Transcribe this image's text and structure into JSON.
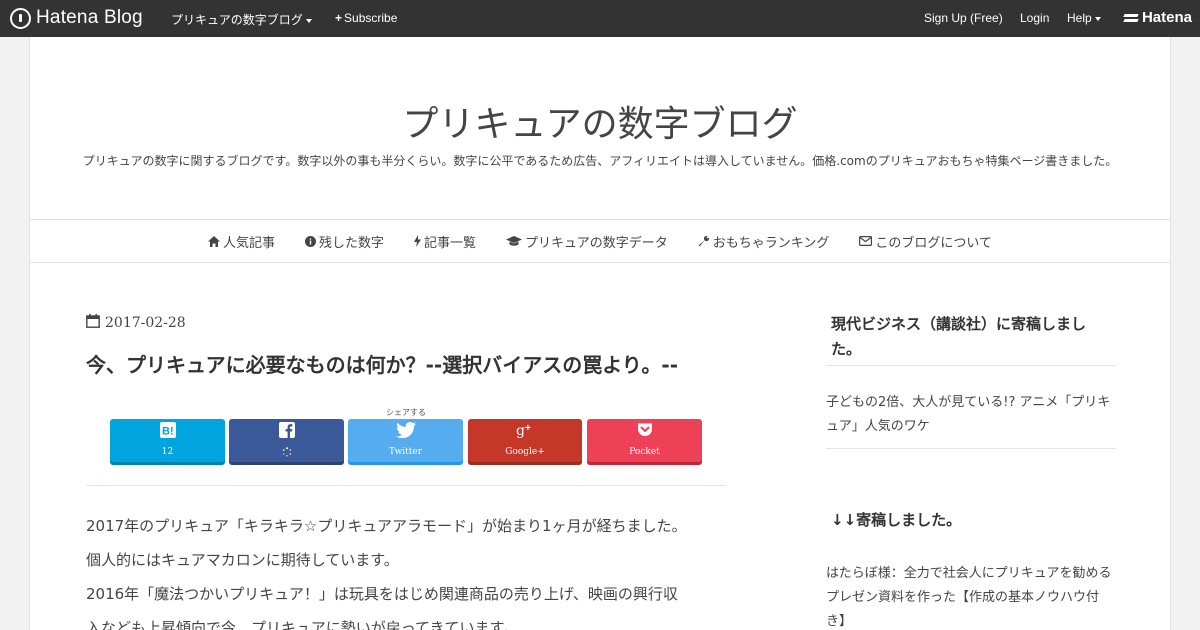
{
  "topbar": {
    "logo_text": "Hatena Blog",
    "blog_menu": "プリキュアの数字ブログ",
    "subscribe": "Subscribe",
    "signup": "Sign Up (Free)",
    "login": "Login",
    "help": "Help",
    "brand": "Hatena"
  },
  "header": {
    "title": "プリキュアの数字ブログ",
    "description": "プリキュアの数字に関するブログです。数字以外の事も半分くらい。数字に公平であるため広告、アフィリエイトは導入していません。価格.comのプリキュアおもちゃ特集ページ書きました。"
  },
  "nav": [
    {
      "label": "人気記事",
      "icon": "home-icon"
    },
    {
      "label": "残した数字",
      "icon": "info-circle-icon"
    },
    {
      "label": "記事一覧",
      "icon": "bolt-icon"
    },
    {
      "label": "プリキュアの数字データ",
      "icon": "graduation-cap-icon"
    },
    {
      "label": "おもちゃランキング",
      "icon": "wrench-icon"
    },
    {
      "label": "このブログについて",
      "icon": "envelope-icon"
    }
  ],
  "article": {
    "date": "2017-02-28",
    "title": "今、プリキュアに必要なものは何か？--選択バイアスの罠より。--",
    "share_label": "シェアする",
    "share": {
      "hatena_count": "12",
      "twitter": "Twitter",
      "googleplus": "Google+",
      "pocket": "Pocket"
    },
    "paragraphs": [
      "2017年のプリキュア「キラキラ☆プリキュアアラモード」が始まり1ヶ月が経ちました。",
      "個人的にはキュアマカロンに期待しています。",
      "2016年「魔法つかいプリキュア！」は玩具をはじめ関連商品の売り上げ、映画の興行収",
      "入なども上昇傾向で今、プリキュアに勢いが戻ってきています。"
    ]
  },
  "sidebar": {
    "section1_title_line1": "現代ビジネス（講談社）に寄稿しまし",
    "section1_title_line2": "た。",
    "section1_link_line1": "子どもの2倍、大人が見ている!? アニメ「プリキ",
    "section1_link_line2": "ュア」人気のワケ",
    "section2_title": "↓↓寄稿しました。",
    "section2_link_line1": "はたらぼ様：全力で社会人にプリキュアを勧める",
    "section2_link_line2": "プレゼン資料を作った【作成の基本ノウハウ付",
    "section2_link_line3": "き】"
  },
  "colors": {
    "topbar": "#333333",
    "hatena_bookmark": "#00a4de",
    "facebook": "#3b5998",
    "twitter": "#55acee",
    "googleplus": "#c53829",
    "pocket": "#ee4056"
  }
}
